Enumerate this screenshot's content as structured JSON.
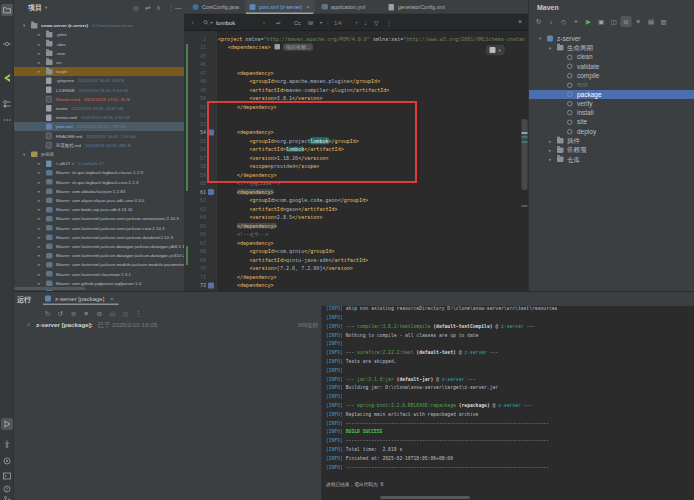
{
  "project": {
    "header": {
      "title": "项目"
    },
    "header_icons": [
      "locate-icon",
      "swap-icon",
      "collapse-all-icon",
      "more-icon",
      "hide-icon"
    ],
    "tree": [
      {
        "ind": 1,
        "arrow": "down",
        "icon": "folder",
        "name": "snow-server (z-server)",
        "meta": "D:\\clone\\snow-server",
        "bold": true
      },
      {
        "ind": 2,
        "arrow": "right",
        "icon": "folder",
        "name": ".gitee"
      },
      {
        "ind": 2,
        "arrow": "right",
        "icon": "folder",
        "name": ".idea"
      },
      {
        "ind": 2,
        "arrow": "right",
        "icon": "folder",
        "name": ".mvn"
      },
      {
        "ind": 2,
        "arrow": "right",
        "icon": "folder",
        "name": "src"
      },
      {
        "ind": 2,
        "arrow": "right",
        "icon": "folder",
        "name": "target",
        "band": "#7a5a1e"
      },
      {
        "ind": 2,
        "icon": "file",
        "name": ".gitignore",
        "meta": "2022/9/24 18:06, 303 B"
      },
      {
        "ind": 2,
        "icon": "file",
        "name": "LICENSE",
        "meta": "2022/9/24 18:06, 9.54 kB"
      },
      {
        "ind": 2,
        "icon": "md",
        "name": "Manifest.md",
        "meta": "2024/10/29 17:01, 45 B",
        "cls": "red"
      },
      {
        "ind": 2,
        "icon": "file",
        "name": "mvnw",
        "meta": "2022/9/24 18:06, 10.67 kB"
      },
      {
        "ind": 2,
        "icon": "file",
        "name": "mvnw.cmd",
        "meta": "2022/9/24 18:06, 6.61 kB"
      },
      {
        "ind": 2,
        "icon": "maven",
        "name": "pom.xml",
        "meta": "2025/2/10 18:03, 7.91 kB",
        "band": "#4c5a66",
        "cls": "blue"
      },
      {
        "ind": 2,
        "icon": "md",
        "name": "README.md",
        "meta": "2022/9/24 18:06, 2.56 kB"
      },
      {
        "ind": 2,
        "icon": "md",
        "name": "部署教程.md",
        "meta": "2022/9/24 18:06, 892 B"
      },
      {
        "ind": 1,
        "arrow": "down",
        "icon": "lib",
        "name": "外部库"
      },
      {
        "ind": 2,
        "arrow": "right",
        "icon": "jdk",
        "name": "< jdk17 >",
        "meta": "D:\\soft\\jdk-17"
      },
      {
        "ind": 2,
        "arrow": "right",
        "icon": "mlib",
        "name": "Maven: ch.qos.logback:logback-classic:1.2.3"
      },
      {
        "ind": 2,
        "arrow": "right",
        "icon": "mlib",
        "name": "Maven: ch.qos.logback:logback-core:1.2.3"
      },
      {
        "ind": 2,
        "arrow": "right",
        "icon": "mlib",
        "name": "Maven: com.alibaba:fastjson:1.2.83"
      },
      {
        "ind": 2,
        "arrow": "right",
        "icon": "mlib",
        "name": "Maven: com.aliyun:aliyun-java-sdk-core:4.5.0"
      },
      {
        "ind": 2,
        "arrow": "right",
        "icon": "mlib",
        "name": "Maven: com.baidu.aip:java-sdk:4.16.16"
      },
      {
        "ind": 2,
        "arrow": "right",
        "icon": "mlib",
        "name": "Maven: com.fasterxml.jackson.core:jackson-annotations:2.10.3"
      },
      {
        "ind": 2,
        "arrow": "right",
        "icon": "mlib",
        "name": "Maven: com.fasterxml.jackson.core:jackson-core:2.10.3"
      },
      {
        "ind": 2,
        "arrow": "right",
        "icon": "mlib",
        "name": "Maven: com.fasterxml.jackson.core:jackson-databind:2.10.3"
      },
      {
        "ind": 2,
        "arrow": "right",
        "icon": "mlib",
        "name": "Maven: com.fasterxml.jackson.datatype:jackson-datatype-jdk8:2.10.3"
      },
      {
        "ind": 2,
        "arrow": "right",
        "icon": "mlib",
        "name": "Maven: com.fasterxml.jackson.datatype:jackson-datatype-jsr310:2.10.3"
      },
      {
        "ind": 2,
        "arrow": "right",
        "icon": "mlib",
        "name": "Maven: com.fasterxml.jackson.module:jackson-module-parameter-names:2.10.3"
      },
      {
        "ind": 2,
        "arrow": "right",
        "icon": "mlib",
        "name": "Maven: com.fasterxml:classmate:1.5.1"
      },
      {
        "ind": 2,
        "arrow": "right",
        "icon": "mlib",
        "name": "Maven: com.github.jsqlparser:jsqlparser:1.0"
      },
      {
        "ind": 2,
        "arrow": "right",
        "icon": "mlib",
        "name": "Maven: com.github.pagehelper:pagehelper:5.1.2"
      }
    ]
  },
  "editor": {
    "tabs": [
      {
        "label": "CorsConfig.java",
        "icon": "class"
      },
      {
        "label": "pom.xml (z-server)",
        "icon": "maven",
        "active": true,
        "close": "×"
      },
      {
        "label": "application.yml",
        "icon": "yml"
      },
      {
        "label": "generatorConfig.xml",
        "icon": "xml"
      }
    ],
    "search": {
      "query": "lombok",
      "count": "1/4",
      "match_case_label": "Cc",
      "words_label": "W",
      "close_label": "×"
    },
    "fold_badge": "项目依赖...",
    "code": [
      {
        "ln": "1",
        "ind": 0,
        "parts": [
          [
            "g",
            "<project "
          ],
          [
            "a",
            "xmlns="
          ],
          [
            "s",
            "\"http://maven.apache.org/POM/4.0.0\""
          ],
          [
            "a",
            " xmlns:xsi="
          ],
          [
            "s",
            "\"http://www.w3.org/2001/XMLSchema-instan"
          ]
        ]
      },
      {
        "ln": "21",
        "ind": 1,
        "parts": [
          [
            "g",
            "<dependencies>"
          ]
        ],
        "badge": true
      },
      {
        "ln": "45",
        "ind": 0,
        "parts": []
      },
      {
        "ln": "46",
        "ind": 0,
        "parts": []
      },
      {
        "ln": "47",
        "ind": 2,
        "parts": [
          [
            "g",
            "<dependency>"
          ]
        ]
      },
      {
        "ln": "48",
        "ind": 3,
        "parts": [
          [
            "g",
            "<groupId>"
          ],
          [
            "t",
            "org.apache.maven.plugins"
          ],
          [
            "g",
            "</groupId>"
          ]
        ]
      },
      {
        "ln": "49",
        "ind": 3,
        "parts": [
          [
            "g",
            "<artifactId>"
          ],
          [
            "t",
            "maven-compiler-plugin"
          ],
          [
            "g",
            "</artifactId>"
          ]
        ]
      },
      {
        "ln": "50",
        "ind": 3,
        "parts": [
          [
            "g",
            "<version>"
          ],
          [
            "t",
            "3.8.1"
          ],
          [
            "g",
            "</version>"
          ]
        ]
      },
      {
        "ln": "51",
        "ind": 2,
        "parts": [
          [
            "g",
            "</dependency>"
          ]
        ]
      },
      {
        "ln": "52",
        "ind": 0,
        "parts": []
      },
      {
        "ln": "53",
        "ind": 0,
        "parts": []
      },
      {
        "ln": "54",
        "ind": 2,
        "parts": [
          [
            "g",
            "<dependency>"
          ]
        ],
        "gic": true,
        "br": true
      },
      {
        "ln": "55",
        "ind": 3,
        "parts": [
          [
            "g",
            "<groupId>"
          ],
          [
            "t",
            "org.project"
          ],
          [
            "hlc",
            "lombok"
          ],
          [
            "g",
            "</groupId>"
          ]
        ]
      },
      {
        "ln": "56",
        "ind": 3,
        "parts": [
          [
            "g",
            "<artifactId>"
          ],
          [
            "hl",
            "lombok"
          ],
          [
            "g",
            "</artifactId>"
          ]
        ]
      },
      {
        "ln": "57",
        "ind": 3,
        "parts": [
          [
            "g",
            "<version>"
          ],
          [
            "t",
            "1.18.20"
          ],
          [
            "g",
            "</version>"
          ]
        ]
      },
      {
        "ln": "58",
        "ind": 3,
        "parts": [
          [
            "g",
            "<scope>"
          ],
          [
            "t",
            "provided"
          ],
          [
            "g",
            "</scope>"
          ]
        ]
      },
      {
        "ln": "59",
        "ind": 2,
        "parts": [
          [
            "g",
            "</dependency>"
          ]
        ]
      },
      {
        "ln": "60",
        "ind": 2,
        "parts": [
          [
            "c",
            "<!--谷歌JSON-->"
          ]
        ]
      },
      {
        "ln": "61",
        "ind": 2,
        "parts": [
          [
            "gband",
            "<dependency>"
          ]
        ],
        "gic": true,
        "br": true
      },
      {
        "ln": "62",
        "ind": 3,
        "parts": [
          [
            "g",
            "<groupId>"
          ],
          [
            "t",
            "com.google.code.gson"
          ],
          [
            "g",
            "</groupId>"
          ]
        ]
      },
      {
        "ln": "63",
        "ind": 3,
        "parts": [
          [
            "g",
            "<artifactId>"
          ],
          [
            "t",
            "gson"
          ],
          [
            "g",
            "</artifactId>"
          ]
        ]
      },
      {
        "ln": "64",
        "ind": 3,
        "parts": [
          [
            "g",
            "<version>"
          ],
          [
            "t",
            "2.8.5"
          ],
          [
            "g",
            "</version>"
          ]
        ]
      },
      {
        "ln": "65",
        "ind": 2,
        "parts": [
          [
            "gband",
            "</dependency>"
          ]
        ]
      },
      {
        "ln": "66",
        "ind": 2,
        "parts": [
          [
            "c",
            "<!--七牛-->"
          ]
        ]
      },
      {
        "ln": "67",
        "ind": 2,
        "parts": [
          [
            "g",
            "<dependency>"
          ]
        ]
      },
      {
        "ln": "68",
        "ind": 3,
        "parts": [
          [
            "g",
            "<groupId>"
          ],
          [
            "t",
            "com.qiniu"
          ],
          [
            "g",
            "</groupId>"
          ]
        ]
      },
      {
        "ln": "69",
        "ind": 3,
        "parts": [
          [
            "g",
            "<artifactId>"
          ],
          [
            "t",
            "qiniu-java-sdk"
          ],
          [
            "g",
            "</artifactId>"
          ]
        ]
      },
      {
        "ln": "70",
        "ind": 3,
        "parts": [
          [
            "g",
            "<version>"
          ],
          [
            "t",
            "[7.2.0, 7.2.99]"
          ],
          [
            "g",
            "</version>"
          ]
        ]
      },
      {
        "ln": "71",
        "ind": 2,
        "parts": [
          [
            "g",
            "</dependency>"
          ]
        ]
      },
      {
        "ln": "72",
        "ind": 2,
        "parts": [
          [
            "g",
            "<dependency>"
          ]
        ],
        "gic": true,
        "br": true
      }
    ]
  },
  "maven": {
    "title": "Maven",
    "toolbar": [
      "reimport-icon",
      "download-sources-icon",
      "settings-icon",
      "add-icon",
      "run-icon",
      "execute-goal-icon",
      "dependencies-icon",
      "skip-tests-icon",
      "offline-icon",
      "expand-all-icon",
      "collapse-all-icon"
    ],
    "tree": [
      {
        "ind": 0,
        "arrow": "down",
        "icon": "maven",
        "name": "z-server"
      },
      {
        "ind": 1,
        "arrow": "down",
        "icon": "folder",
        "name": "生命周期"
      },
      {
        "ind": 2,
        "icon": "goal",
        "name": "clean"
      },
      {
        "ind": 2,
        "icon": "goal",
        "name": "validate"
      },
      {
        "ind": 2,
        "icon": "goal",
        "name": "compile"
      },
      {
        "ind": 2,
        "icon": "goal",
        "name": "test",
        "dim": true
      },
      {
        "ind": 2,
        "icon": "goal",
        "name": "package",
        "selected": true
      },
      {
        "ind": 2,
        "icon": "goal",
        "name": "verify"
      },
      {
        "ind": 2,
        "icon": "goal",
        "name": "install"
      },
      {
        "ind": 2,
        "icon": "goal",
        "name": "site"
      },
      {
        "ind": 2,
        "icon": "goal",
        "name": "deploy"
      },
      {
        "ind": 1,
        "arrow": "right",
        "icon": "folder",
        "name": "插件"
      },
      {
        "ind": 1,
        "arrow": "right",
        "icon": "folder",
        "name": "依赖项"
      },
      {
        "ind": 1,
        "arrow": "right",
        "icon": "folder",
        "name": "仓库"
      }
    ]
  },
  "run": {
    "label": "运行",
    "tab": {
      "label": "z-server [package]",
      "close": "×"
    },
    "toolbar": [
      "rerun-icon",
      "rerun-failed-icon",
      "stop-icon",
      "filter-icon",
      "expand-all-icon",
      "collapse-all-icon",
      "history-icon",
      "more-icon"
    ],
    "node": {
      "check": "✓",
      "name": "z-server [package]:",
      "time": "已于 2025/2/10 18:05",
      "duration": "969毫秒"
    },
    "console": [
      [
        [
          "i",
          "[INFO]"
        ],
        [
          "p",
          " skip non existing resourceDirectory D:\\clone\\snow-server\\src\\test\\resources"
        ]
      ],
      [
        [
          "i",
          "[INFO]"
        ]
      ],
      [
        [
          "i",
          "[INFO]"
        ],
        [
          "p",
          " --- "
        ],
        [
          "gr",
          "compiler:3.8.1:testCompile"
        ],
        [
          "p",
          " "
        ],
        [
          "b",
          "(default-testCompile)"
        ],
        [
          "p",
          " @ "
        ],
        [
          "cy",
          "z-server"
        ],
        [
          "p",
          " ---"
        ]
      ],
      [
        [
          "i",
          "[INFO]"
        ],
        [
          "p",
          " Nothing to compile - all classes are up to date"
        ]
      ],
      [
        [
          "i",
          "[INFO]"
        ]
      ],
      [
        [
          "i",
          "[INFO]"
        ],
        [
          "p",
          " --- "
        ],
        [
          "gr",
          "surefire:2.22.2:test"
        ],
        [
          "p",
          " "
        ],
        [
          "b",
          "(default-test)"
        ],
        [
          "p",
          " @ "
        ],
        [
          "cy",
          "z-server"
        ],
        [
          "p",
          " ---"
        ]
      ],
      [
        [
          "i",
          "[INFO]"
        ],
        [
          "p",
          " Tests are skipped."
        ]
      ],
      [
        [
          "i",
          "[INFO]"
        ]
      ],
      [
        [
          "i",
          "[INFO]"
        ],
        [
          "p",
          " --- "
        ],
        [
          "gr",
          "jar:3.1.0:jar"
        ],
        [
          "p",
          " "
        ],
        [
          "b",
          "(default-jar)"
        ],
        [
          "p",
          " @ "
        ],
        [
          "cy",
          "z-server"
        ],
        [
          "p",
          " ---"
        ]
      ],
      [
        [
          "i",
          "[INFO]"
        ],
        [
          "p",
          " Building jar: D:\\clone\\snow-server\\target\\z-server.jar"
        ]
      ],
      [
        [
          "i",
          "[INFO]"
        ]
      ],
      [
        [
          "i",
          "[INFO]"
        ],
        [
          "p",
          " --- "
        ],
        [
          "gr",
          "spring-boot:2.2.6.RELEASE:repackage"
        ],
        [
          "p",
          " "
        ],
        [
          "b",
          "(repackage)"
        ],
        [
          "p",
          " @ "
        ],
        [
          "cy",
          "z-server"
        ],
        [
          "p",
          " ---"
        ]
      ],
      [
        [
          "i",
          "[INFO]"
        ],
        [
          "p",
          " Replacing main artifact with repackaged archive"
        ]
      ],
      [
        [
          "i",
          "[INFO]"
        ],
        [
          "p",
          " ------------------------------------------------------------------------"
        ]
      ],
      [
        [
          "i",
          "[INFO]"
        ],
        [
          "gn",
          " BUILD SUCCESS"
        ]
      ],
      [
        [
          "i",
          "[INFO]"
        ],
        [
          "p",
          " ------------------------------------------------------------------------"
        ]
      ],
      [
        [
          "i",
          "[INFO]"
        ],
        [
          "p",
          " Total time:  2.819 s"
        ]
      ],
      [
        [
          "i",
          "[INFO]"
        ],
        [
          "p",
          " Finished at: 2025-02-10T18:05:06+08:00"
        ]
      ],
      [
        [
          "i",
          "[INFO]"
        ],
        [
          "p",
          " ------------------------------------------------------------------------"
        ]
      ],
      [],
      [
        [
          "p",
          "进程已结束，退出代码为 0"
        ]
      ]
    ]
  }
}
